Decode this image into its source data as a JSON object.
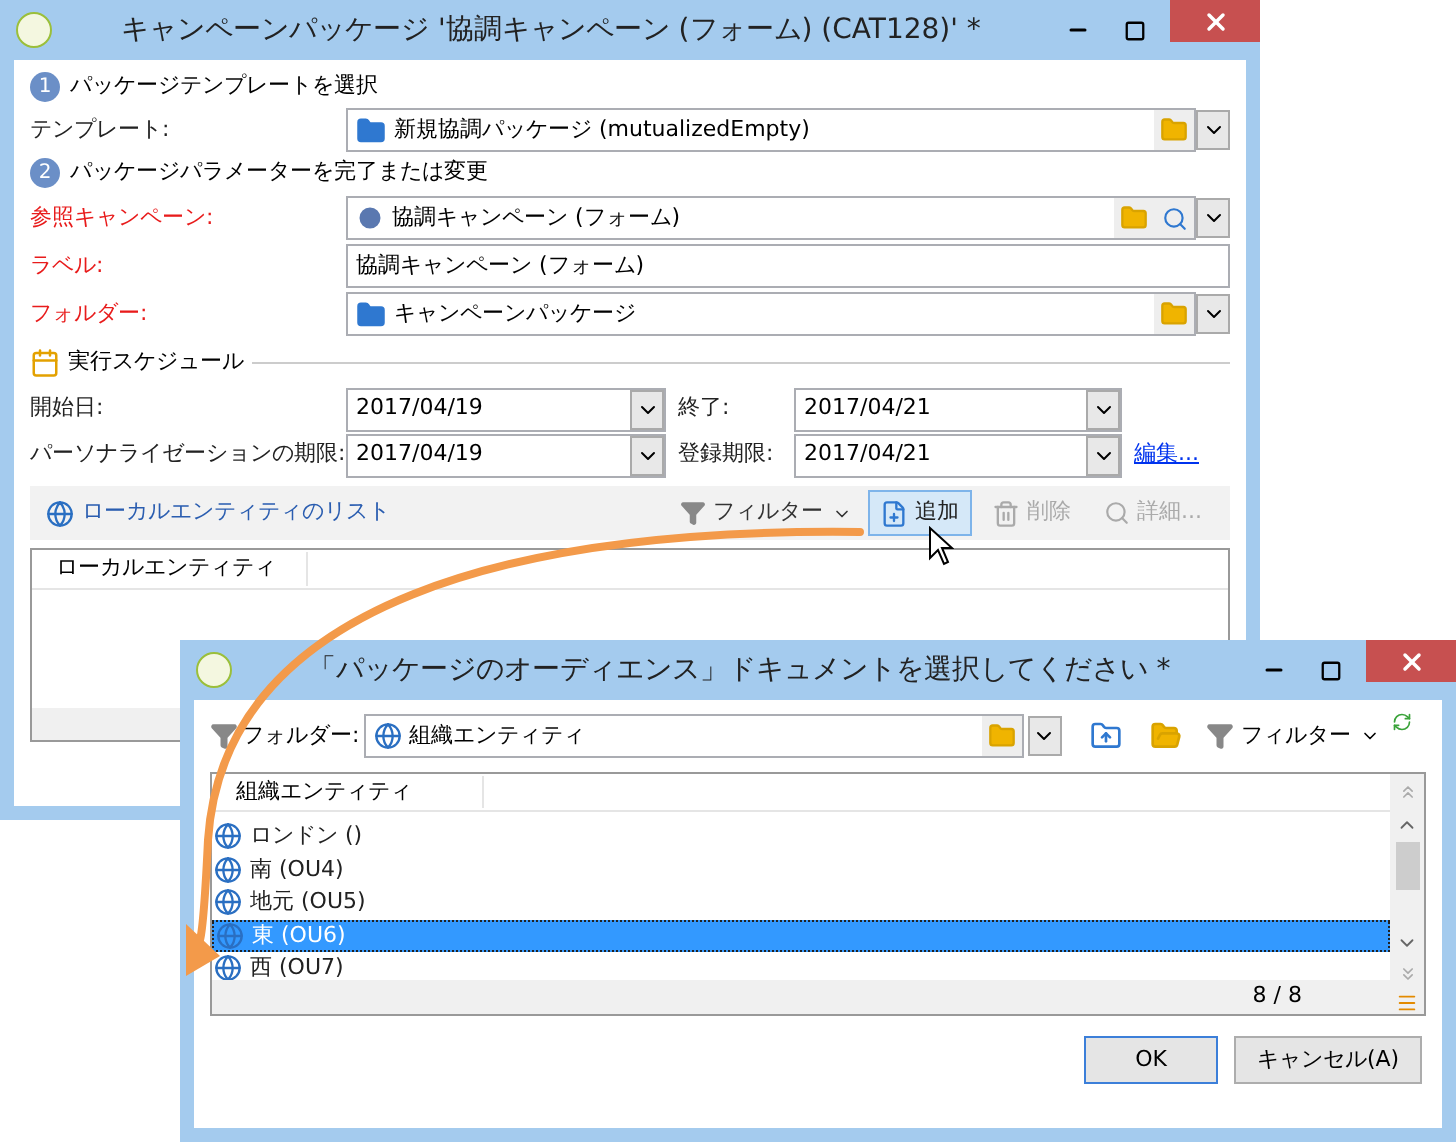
{
  "main_window": {
    "title": "キャンペーンパッケージ '協調キャンペーン (フォーム) (CAT128)' *",
    "steps": [
      {
        "number": "1",
        "label": "パッケージテンプレートを選択"
      },
      {
        "number": "2",
        "label": "パッケージパラメーターを完了または変更"
      }
    ],
    "template": {
      "label": "テンプレート:",
      "value": "新規協調パッケージ (mutualizedEmpty)"
    },
    "fields": [
      {
        "kind": "campaign",
        "label": "参照キャンペーン:",
        "value": "協調キャンペーン (フォーム)",
        "required": true
      },
      {
        "kind": "text",
        "label": "ラベル:",
        "value": "協調キャンペーン (フォーム)",
        "required": true
      },
      {
        "kind": "folder",
        "label": "フォルダー:",
        "value": "キャンペーンパッケージ",
        "required": true
      }
    ],
    "schedule": {
      "title": "実行スケジュール",
      "start_label": "開始日:",
      "start": "2017/04/19",
      "end_label": "終了:",
      "end": "2017/04/21",
      "personalization_label": "パーソナライゼーションの期限:",
      "personalization": "2017/04/19",
      "registration_label": "登録期限:",
      "registration": "2017/04/21",
      "edit_link": "編集..."
    },
    "toolbar": {
      "list_link": "ローカルエンティティのリスト",
      "filter": "フィルター",
      "buttons": [
        {
          "kind": "add",
          "label": "追加",
          "disabled": false,
          "hovered": true
        },
        {
          "kind": "delete",
          "label": "削除",
          "disabled": true,
          "hovered": false
        },
        {
          "kind": "details",
          "label": "詳細...",
          "disabled": true,
          "hovered": false
        }
      ]
    },
    "grid": {
      "column": "ローカルエンティティ"
    }
  },
  "dialog": {
    "title": "「パッケージのオーディエンス」ドキュメントを選択してください *",
    "folder_label": "フォルダー:",
    "folder_value": "組織エンティティ",
    "filter": "フィルター",
    "column": "組織エンティティ",
    "rows": [
      {
        "label": "ロンドン ()",
        "selected": false
      },
      {
        "label": "南 (OU4)",
        "selected": false
      },
      {
        "label": "地元 (OU5)",
        "selected": false
      },
      {
        "label": "東 (OU6)",
        "selected": true
      },
      {
        "label": "西 (OU7)",
        "selected": false
      }
    ],
    "count": "8 / 8",
    "ok": "OK",
    "cancel": "キャンセル(A)"
  }
}
